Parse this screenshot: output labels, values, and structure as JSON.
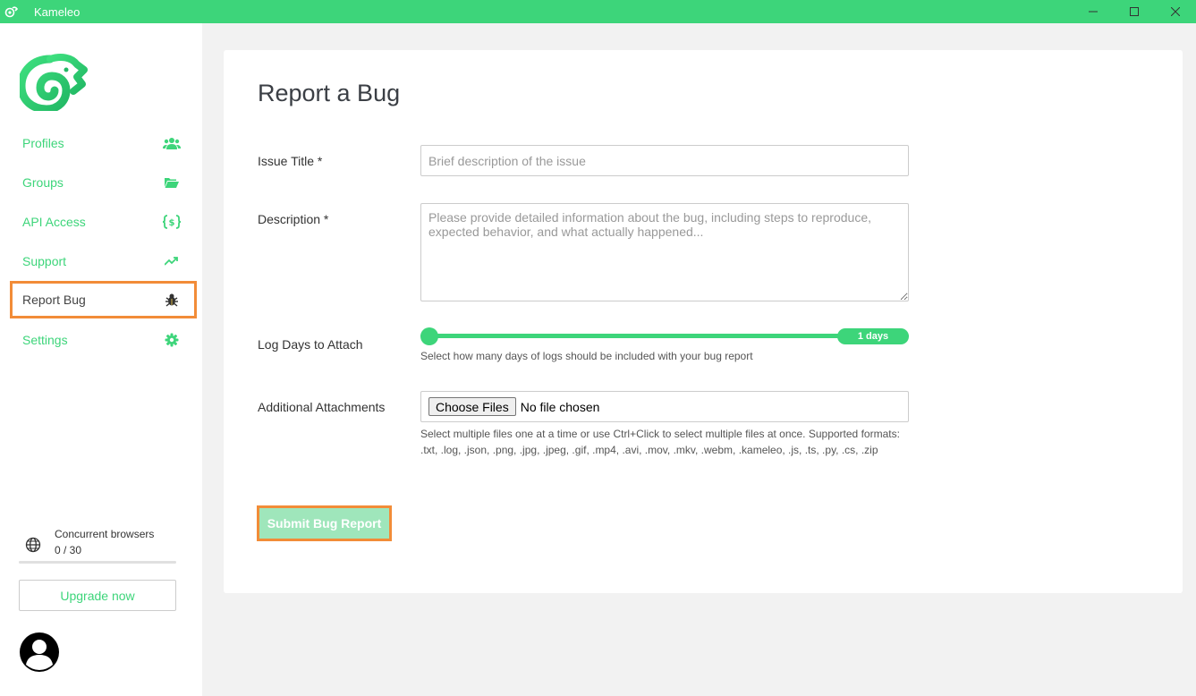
{
  "window": {
    "title": "Kameleo",
    "accent": "#3dd57a",
    "highlight": "#f28c38"
  },
  "sidebar": {
    "items": [
      {
        "label": "Profiles",
        "icon": "users-icon"
      },
      {
        "label": "Groups",
        "icon": "folder-open-icon"
      },
      {
        "label": "API Access",
        "icon": "code-braces-icon"
      },
      {
        "label": "Support",
        "icon": "trend-up-icon"
      },
      {
        "label": "Report Bug",
        "icon": "bug-icon",
        "active": true
      },
      {
        "label": "Settings",
        "icon": "gear-icon"
      }
    ],
    "concurrent": {
      "label": "Concurrent browsers",
      "count": "0 / 30",
      "used": 0,
      "max": 30
    },
    "upgrade_label": "Upgrade now"
  },
  "form": {
    "title": "Report a Bug",
    "issue_title": {
      "label": "Issue Title *",
      "placeholder": "Brief description of the issue",
      "value": ""
    },
    "description": {
      "label": "Description *",
      "placeholder": "Please provide detailed information about the bug, including steps to reproduce, expected behavior, and what actually happened...",
      "value": ""
    },
    "log_days": {
      "label": "Log Days to Attach",
      "value_label": "1 days",
      "value": 1,
      "hint": "Select how many days of logs should be included with your bug report"
    },
    "attachments": {
      "label": "Additional Attachments",
      "button_label": "Choose Files",
      "status": "No file chosen",
      "hint": "Select multiple files one at a time or use Ctrl+Click to select multiple files at once. Supported formats: .txt, .log, .json, .png, .jpg, .jpeg, .gif, .mp4, .avi, .mov, .mkv, .webm, .kameleo, .js, .ts, .py, .cs, .zip"
    },
    "submit_label": "Submit Bug Report"
  }
}
